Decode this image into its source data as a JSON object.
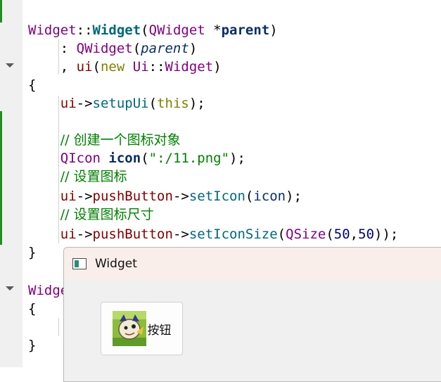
{
  "code": {
    "l1": {
      "cls": "Widget",
      "sep": "::",
      "fn": "Widget",
      "open": "(",
      "type": "QWidget",
      "ptr": " *",
      "param": "parent",
      "close": ")"
    },
    "l2": {
      "prefix": "    : ",
      "type": "QWidget",
      "open": "(",
      "param": "parent",
      "close": ")"
    },
    "l3": {
      "prefix": "    , ",
      "member": "ui",
      "open": "(",
      "kw": "new",
      "sp": " ",
      "ns": "Ui",
      "sep": "::",
      "cls": "Widget",
      "close": ")"
    },
    "l4": {
      "text": "{"
    },
    "l5": {
      "prefix": "    ",
      "member": "ui",
      "arrow": "->",
      "fn": "setupUi",
      "open": "(",
      "kw": "this",
      "close": ");"
    },
    "l7": {
      "prefix": "    ",
      "comment": "// 创建一个图标对象"
    },
    "l8": {
      "prefix": "    ",
      "type": "QIcon",
      "sp": " ",
      "var": "icon",
      "open": "(",
      "str": "\":/11.png\"",
      "close": ");"
    },
    "l9": {
      "prefix": "    ",
      "comment": "// 设置图标"
    },
    "l10": {
      "prefix": "    ",
      "member": "ui",
      "arrow": "->",
      "member2": "pushButton",
      "arrow2": "->",
      "fn": "setIcon",
      "open": "(",
      "arg": "icon",
      "close": ");"
    },
    "l11": {
      "prefix": "    ",
      "comment": "// 设置图标尺寸"
    },
    "l12": {
      "prefix": "    ",
      "member": "ui",
      "arrow": "->",
      "member2": "pushButton",
      "arrow2": "->",
      "fn": "setIconSize",
      "open": "(",
      "type": "QSize",
      "open2": "(",
      "n1": "50",
      "comma": ",",
      "n2": "50",
      "close": "));"
    },
    "l13": {
      "text": "}"
    },
    "l15": {
      "cls": "Widge"
    },
    "l16": {
      "text": "{"
    },
    "l18": {
      "text": "}"
    }
  },
  "window": {
    "title": "Widget",
    "icon": "window-app-icon",
    "button": {
      "label": "按钮",
      "icon": "cartoon-image-icon"
    }
  },
  "colors": {
    "class": "#800080",
    "function": "#00677c",
    "keyword": "#808000",
    "comment": "#008000",
    "member": "#800000",
    "number": "#000080",
    "change_bar": "#1f8f1f"
  }
}
